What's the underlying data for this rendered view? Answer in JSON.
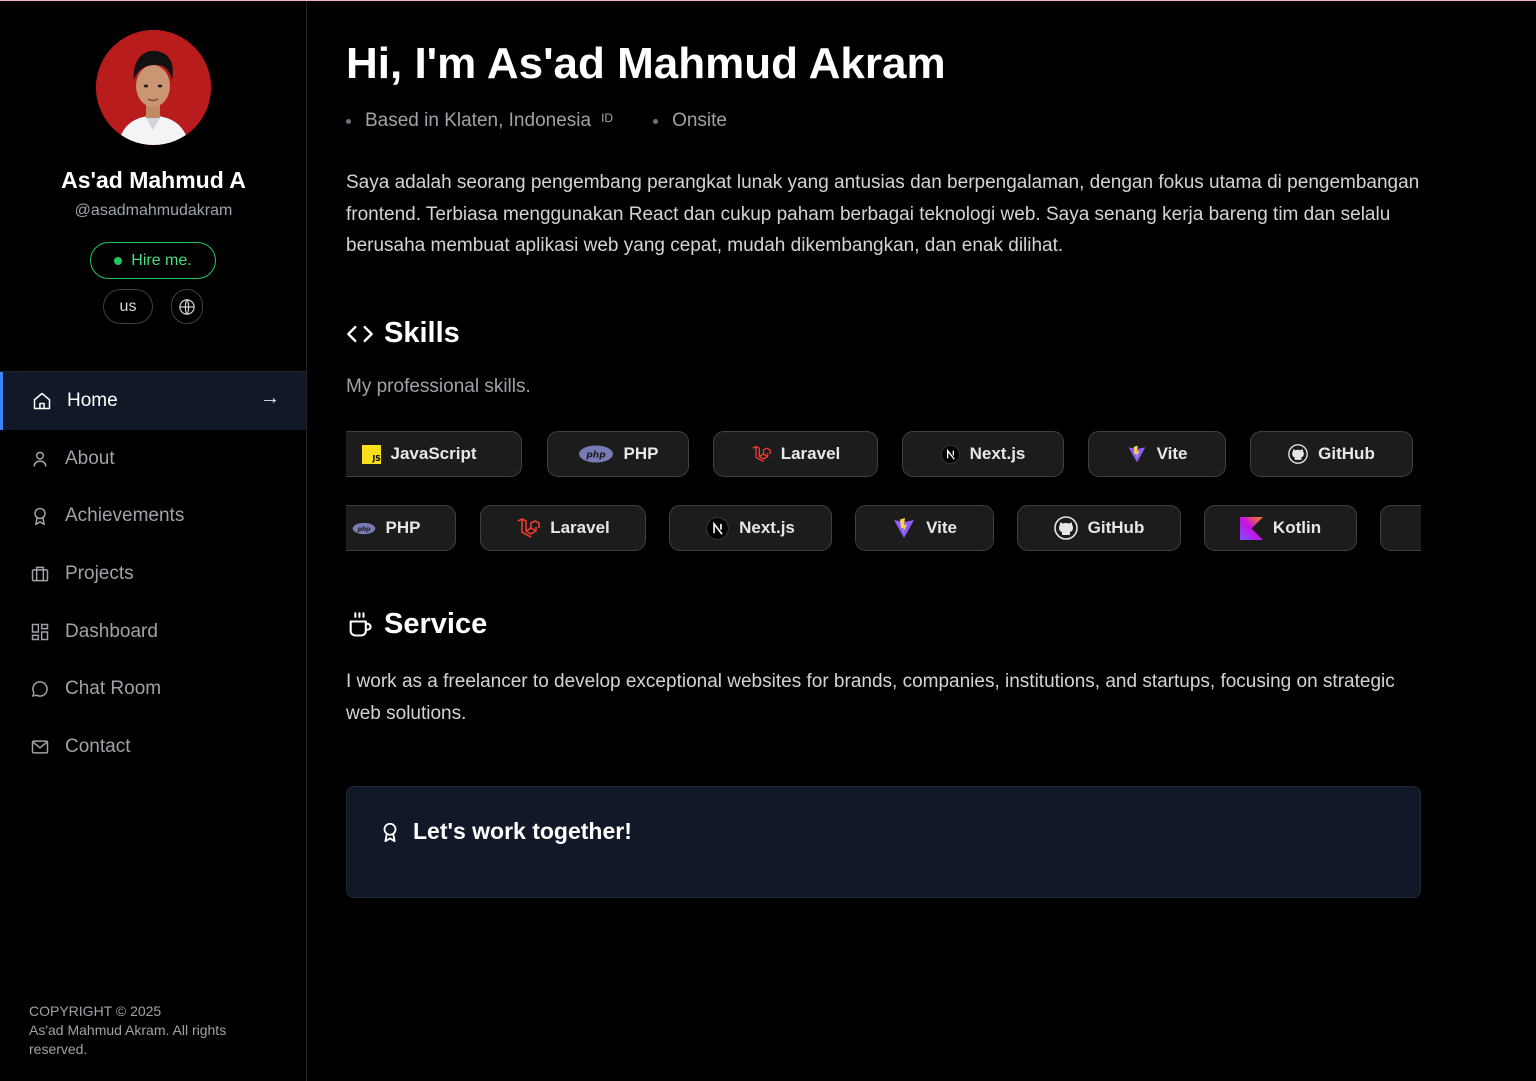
{
  "profile": {
    "name": "As'ad Mahmud A",
    "handle": "@asadmahmudakram",
    "hire_label": "Hire me.",
    "lang_label": "us",
    "status_color": "#22c55e"
  },
  "nav": {
    "items": [
      {
        "label": "Home",
        "icon": "home-icon",
        "active": true
      },
      {
        "label": "About",
        "icon": "user-icon"
      },
      {
        "label": "Achievements",
        "icon": "award-icon"
      },
      {
        "label": "Projects",
        "icon": "briefcase-icon"
      },
      {
        "label": "Dashboard",
        "icon": "dashboard-icon"
      },
      {
        "label": "Chat Room",
        "icon": "chat-icon"
      },
      {
        "label": "Contact",
        "icon": "mail-icon"
      }
    ],
    "active_arrow": "→",
    "accent_color": "#3b82f6"
  },
  "footer": {
    "copyright_line1": "COPYRIGHT © 2025",
    "copyright_line2": "As'ad Mahmud Akram. All rights reserved."
  },
  "hero": {
    "title": "Hi, I'm As'ad Mahmud Akram",
    "location": "Based in Klaten, Indonesia",
    "country_code": "ID",
    "work_mode": "Onsite",
    "intro": "Saya adalah seorang pengembang perangkat lunak yang antusias dan berpengalaman, dengan fokus utama di pengembangan frontend. Terbiasa menggunakan React dan cukup paham berbagai teknologi web. Saya senang kerja bareng tim dan selalu berusaha membuat aplikasi web yang cepat, mudah dikembangkan, dan enak dilihat."
  },
  "skills": {
    "title": "Skills",
    "subtitle": "My professional skills.",
    "row1": [
      {
        "label": "JavaScript",
        "icon": "javascript-icon"
      },
      {
        "label": "PHP",
        "icon": "php-icon"
      },
      {
        "label": "Laravel",
        "icon": "laravel-icon"
      },
      {
        "label": "Next.js",
        "icon": "nextjs-icon"
      },
      {
        "label": "Vite",
        "icon": "vite-icon"
      },
      {
        "label": "GitHub",
        "icon": "github-icon"
      }
    ],
    "row2": [
      {
        "label": "PHP",
        "icon": "php-icon"
      },
      {
        "label": "Laravel",
        "icon": "laravel-icon"
      },
      {
        "label": "Next.js",
        "icon": "nextjs-icon"
      },
      {
        "label": "Vite",
        "icon": "vite-icon"
      },
      {
        "label": "GitHub",
        "icon": "github-icon"
      },
      {
        "label": "Kotlin",
        "icon": "kotlin-icon"
      }
    ]
  },
  "service": {
    "title": "Service",
    "text": "I work as a freelancer to develop exceptional websites for brands, companies, institutions, and startups, focusing on strategic web solutions."
  },
  "cta": {
    "title": "Let's work together!"
  }
}
